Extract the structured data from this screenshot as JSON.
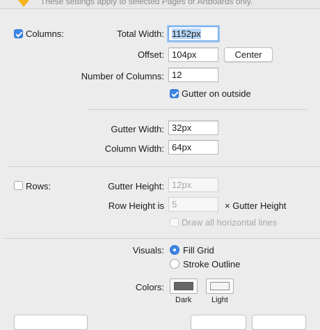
{
  "header": {
    "note": "These settings apply to selected Pages or Artboards only."
  },
  "columns": {
    "enabled": true,
    "label": "Columns:",
    "total_width_label": "Total Width:",
    "total_width_value": "1152px",
    "offset_label": "Offset:",
    "offset_value": "104px",
    "center_button": "Center",
    "number_label": "Number of Columns:",
    "number_value": "12",
    "gutter_outside_label": "Gutter on outside",
    "gutter_outside_checked": true,
    "gutter_width_label": "Gutter Width:",
    "gutter_width_value": "32px",
    "column_width_label": "Column Width:",
    "column_width_value": "64px"
  },
  "rows": {
    "enabled": false,
    "label": "Rows:",
    "gutter_height_label": "Gutter Height:",
    "gutter_height_value": "12px",
    "row_height_label": "Row Height is",
    "row_height_value": "5",
    "row_height_suffix": "× Gutter Height",
    "draw_lines_label": "Draw all horizontal lines",
    "draw_lines_checked": false
  },
  "visuals": {
    "label": "Visuals:",
    "options": [
      "Fill Grid",
      "Stroke Outline"
    ],
    "selected": "Fill Grid"
  },
  "colors": {
    "label": "Colors:",
    "dark_label": "Dark",
    "light_label": "Light",
    "dark_color": "#666666",
    "light_color": "#f4f4f4"
  },
  "colors_theme": {
    "accent": "#3b86e6",
    "focus_ring": "#9ac4f2",
    "selection": "#b7d6f9"
  }
}
